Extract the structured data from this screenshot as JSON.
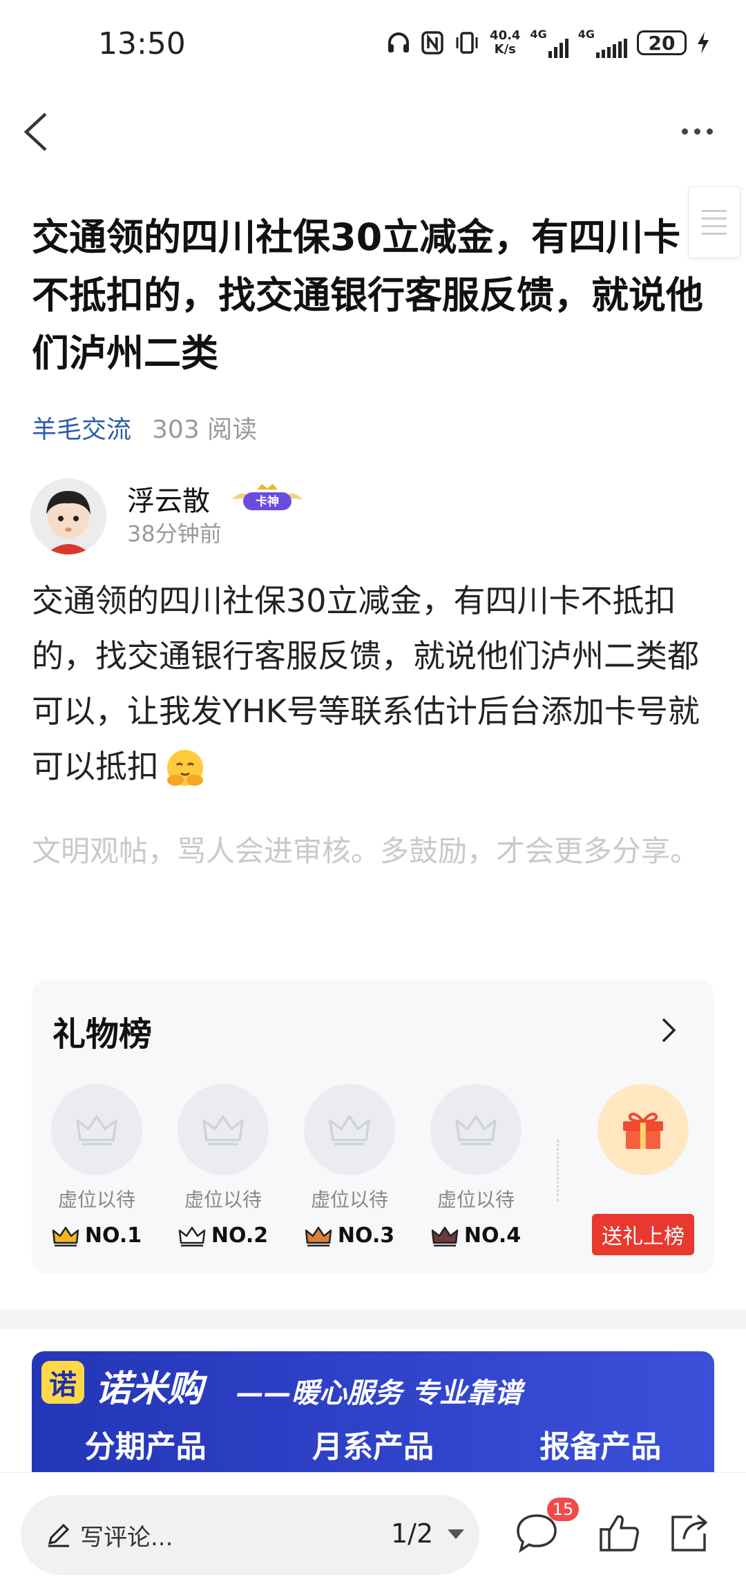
{
  "status_bar": {
    "time": "13:50",
    "net_speed_value": "40.4",
    "net_speed_unit": "K/s",
    "signal1_label": "4G",
    "signal2_label": "4G",
    "battery": "20",
    "icons": [
      "headphones-icon",
      "nfc-icon",
      "vibrate-icon",
      "signal-icon",
      "battery-icon",
      "charging-icon"
    ]
  },
  "nav": {
    "back_icon": "chevron-left-icon",
    "more_icon": "more-horizontal-icon"
  },
  "post": {
    "title": "交通领的四川社保30立减金，有四川卡不抵扣的，找交通银行客服反馈，就说他们泸州二类",
    "forum": "羊毛交流",
    "reads": "303 阅读",
    "author": {
      "name": "浮云散",
      "badge": "卡神",
      "time": "38分钟前"
    },
    "content": "交通领的四川社保30立减金，有四川卡不抵扣的，找交通银行客服反馈，就说他们泸州二类都可以，让我发YHK号等联系估计后台添加卡号就可以抵扣",
    "hint": "文明观帖，骂人会进审核。多鼓励，才会更多分享。"
  },
  "gift_board": {
    "title": "礼物榜",
    "slots": [
      {
        "label": "虚位以待",
        "rank": "NO.1",
        "crown_color": "#f2b51e"
      },
      {
        "label": "虚位以待",
        "rank": "NO.2",
        "crown_color": "#9aa6b8"
      },
      {
        "label": "虚位以待",
        "rank": "NO.3",
        "crown_color": "#d9823b"
      },
      {
        "label": "虚位以待",
        "rank": "NO.4",
        "crown_color": "#6b3b3b"
      }
    ],
    "send_button": "送礼上榜"
  },
  "banner": {
    "logo_char": "诺",
    "brand": "诺米购",
    "slogan": "——暖心服务 专业靠谱",
    "tabs": [
      "分期产品",
      "月系产品",
      "报备产品"
    ]
  },
  "bottom_bar": {
    "comment_placeholder": "写评论...",
    "page_indicator": "1/2",
    "comment_count": "15"
  },
  "colors": {
    "link_blue": "#2a5caa",
    "send_red": "#e8382f",
    "badge_red": "#f04a4a",
    "banner_blue": "#2336b8"
  }
}
